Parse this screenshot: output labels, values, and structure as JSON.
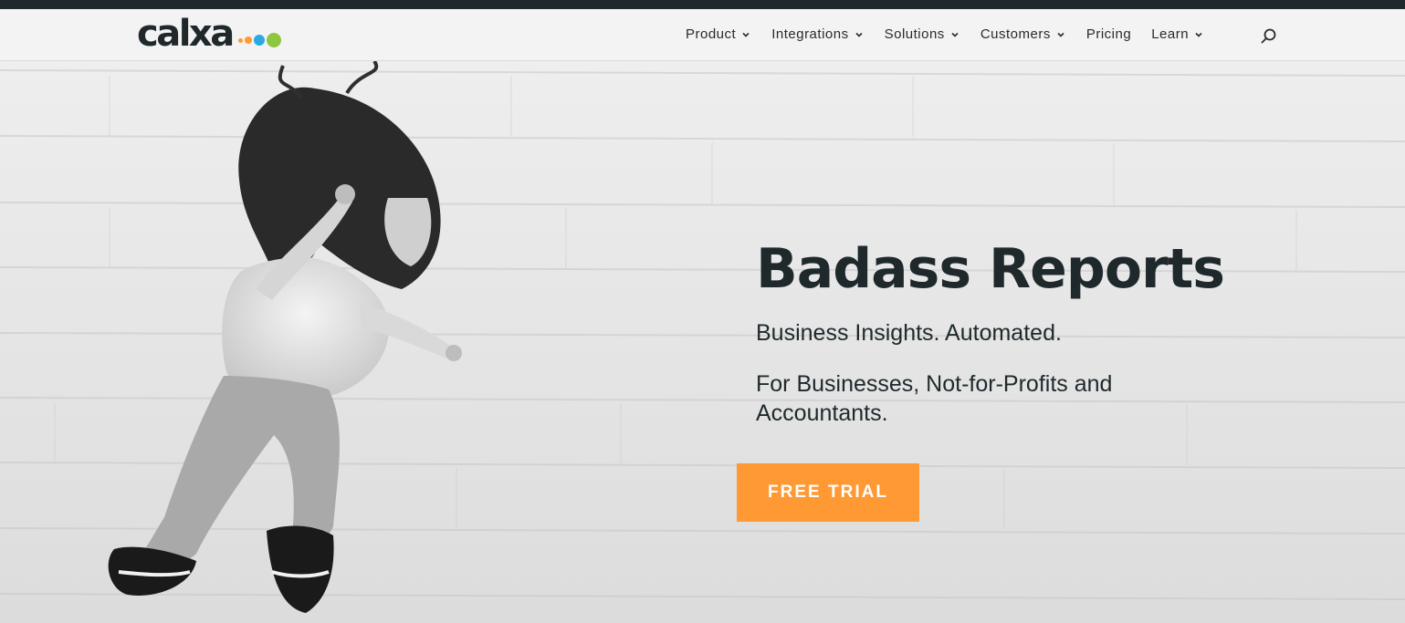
{
  "brand": {
    "name": "calxa",
    "dot_colors": [
      "#ff9933",
      "#ff9933",
      "#29abe2",
      "#8dc63f"
    ]
  },
  "nav": {
    "items": [
      {
        "label": "Product",
        "has_dropdown": true
      },
      {
        "label": "Integrations",
        "has_dropdown": true
      },
      {
        "label": "Solutions",
        "has_dropdown": true
      },
      {
        "label": "Customers",
        "has_dropdown": true
      },
      {
        "label": "Pricing",
        "has_dropdown": false
      },
      {
        "label": "Learn",
        "has_dropdown": true
      }
    ],
    "search_icon": "search-icon"
  },
  "hero": {
    "title": "Badass Reports",
    "subtitle": "Business Insights. Automated.",
    "audience": "For Businesses, Not-for-Profits and Accountants.",
    "cta_label": "FREE TRIAL",
    "image": "black-and-white photo of a young girl jumping in front of a white brick wall"
  },
  "colors": {
    "accent": "#ff9933",
    "dark": "#1f292c",
    "nav_background": "#f3f3f3"
  }
}
